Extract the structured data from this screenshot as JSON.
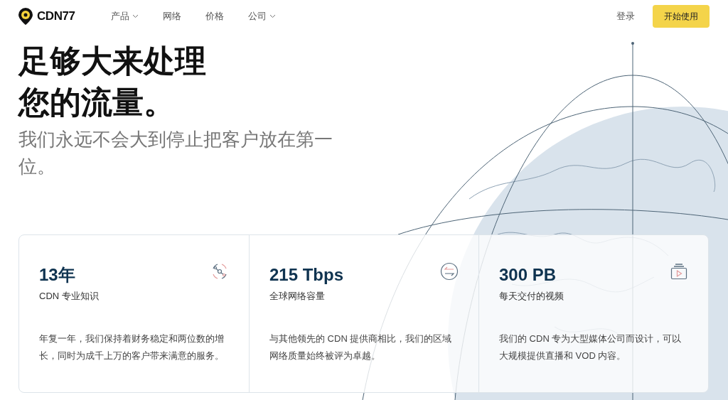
{
  "nav": {
    "brand": "CDN77",
    "links": [
      {
        "label": "产品",
        "dropdown": true
      },
      {
        "label": "网络",
        "dropdown": false
      },
      {
        "label": "价格",
        "dropdown": false
      },
      {
        "label": "公司",
        "dropdown": true
      }
    ],
    "login": "登录",
    "cta": "开始使用"
  },
  "hero": {
    "title_lines": [
      "足够大来处理",
      "您的流量。"
    ],
    "subtitle": "我们永远不会大到停止把客户放在第一位。"
  },
  "stats": [
    {
      "kind": "expertise",
      "value": "13年",
      "label": "CDN 专业知识",
      "text": "年复一年，我们保持着财务稳定和两位数的增长，同时为成千上万的客户带来满意的服务。"
    },
    {
      "kind": "capacity",
      "value": "215 Tbps",
      "label": "全球网络容量",
      "text": "与其他领先的 CDN 提供商相比，我们的区域网络质量始终被评为卓越。"
    },
    {
      "kind": "video",
      "value": "300 PB",
      "label": "每天交付的视频",
      "text": "我们的 CDN 专为大型媒体公司而设计，可以大规模提供直播和 VOD 内容。"
    }
  ]
}
